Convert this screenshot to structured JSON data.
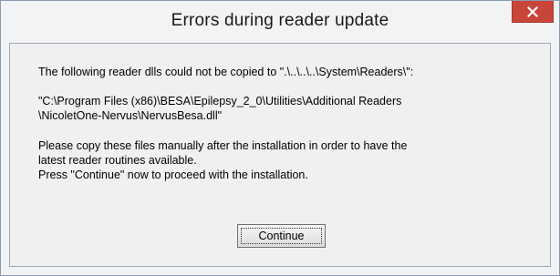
{
  "dialog": {
    "title": "Errors during reader update",
    "close_icon": "close-icon",
    "close_color": "#c9453a",
    "message": {
      "line1": "The following reader dlls could not be copied to \".\\..\\..\\..\\System\\Readers\\\":",
      "path_line1": "\"C:\\Program Files (x86)\\BESA\\Epilepsy_2_0\\Utilities\\Additional Readers",
      "path_line2": "\\NicoletOne-Nervus\\NervusBesa.dll\"",
      "instruction_line1": "Please copy these files manually after the installation in order to have the",
      "instruction_line2": "latest reader routines available.",
      "instruction_line3": "Press \"Continue\" now to proceed with the installation."
    },
    "continue_label": "Continue"
  }
}
